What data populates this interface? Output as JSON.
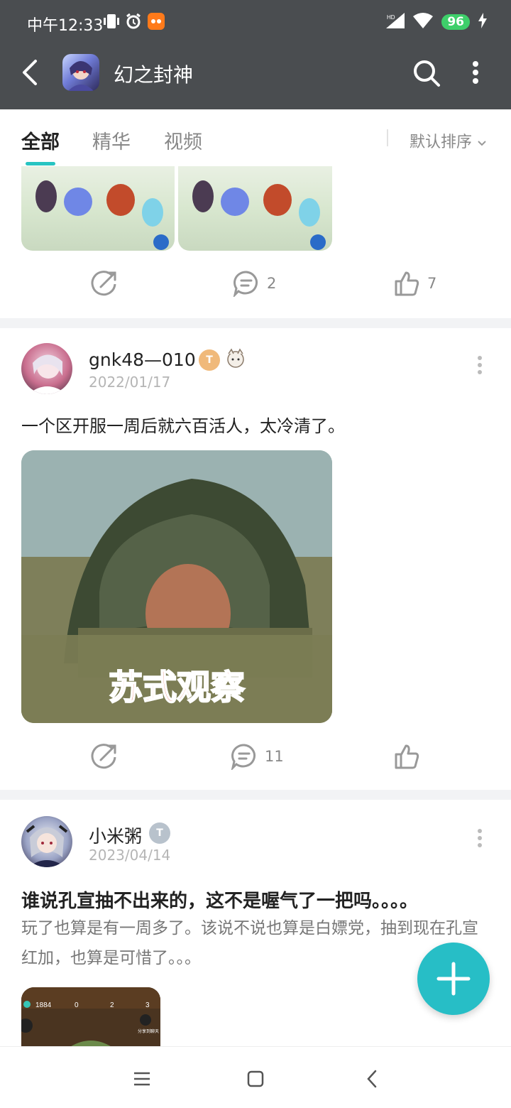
{
  "status_bar": {
    "time": "中午12:33",
    "battery": "96",
    "network": "HD"
  },
  "header": {
    "title": "幻之封神"
  },
  "tabs": {
    "items": [
      "全部",
      "精华",
      "视频"
    ],
    "active": "全部",
    "sort_label": "默认排序"
  },
  "posts": [
    {
      "comments": "2",
      "likes": "7"
    },
    {
      "username": "gnk48—010",
      "date": "2022/01/17",
      "level": "T",
      "text": "一个区开服一周后就六百活人，太冷清了。",
      "image_caption": "苏式观察",
      "comments": "11"
    },
    {
      "username": "小米粥",
      "date": "2023/04/14",
      "level": "T",
      "title": "谁说孔宣抽不出来的，这不是喔气了一把吗。。。。",
      "body": "玩了也算是有一周多了。该说不说也算是白嫖党，抽到现在孔宣红加，也算是可惜了。。。",
      "preview_stats": [
        "1884",
        "0",
        "2",
        "3"
      ],
      "preview_share": "分享到聊天"
    }
  ],
  "colors": {
    "accent": "#27c4c2",
    "header_bg": "#4a4d50"
  }
}
